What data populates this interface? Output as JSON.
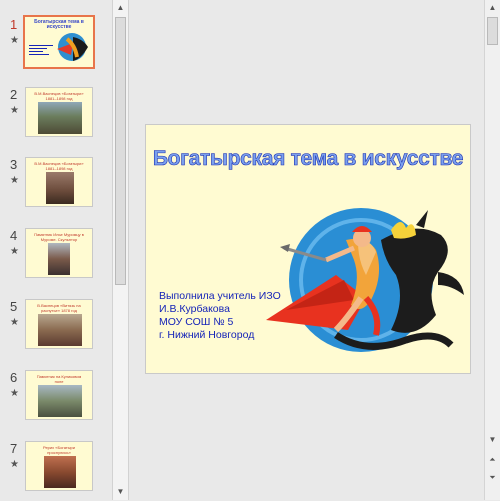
{
  "thumbnails": [
    {
      "number": "1",
      "title": "Богатырская тема в искусстве",
      "active": true
    },
    {
      "number": "2",
      "title": "В.М.Васнецов «Богатыри» 1881–1898 год",
      "active": false
    },
    {
      "number": "3",
      "title": "В.М.Васнецов «Богатыри» 1881–1898 год",
      "active": false
    },
    {
      "number": "4",
      "title": "Памятник Илье Муромцу в Муроме. Скульптор В.М.Клыков",
      "active": false
    },
    {
      "number": "5",
      "title": "В.Васнецов «Витязь на распутье» 1878 год",
      "active": false
    },
    {
      "number": "6",
      "title": "Памятник на Куликовом поле",
      "active": false
    },
    {
      "number": "7",
      "title": "Рерих «Богатыри проснулись»",
      "active": false
    }
  ],
  "slide": {
    "title": "Богатырская тема в искусстве",
    "author_lines": [
      "Выполнила учитель ИЗО",
      "И.В.Курбакова",
      "МОУ СОШ № 5",
      "г. Нижний Новгород"
    ]
  },
  "star_glyph": "★",
  "scroll_up_glyph": "▲",
  "scroll_down_glyph": "▼",
  "prev_slide_glyph": "⏶",
  "next_slide_glyph": "⏷",
  "colors": {
    "active_accent": "#e8744a",
    "slide_background": "#fffbd2",
    "title_blue": "#1c2fb0"
  }
}
